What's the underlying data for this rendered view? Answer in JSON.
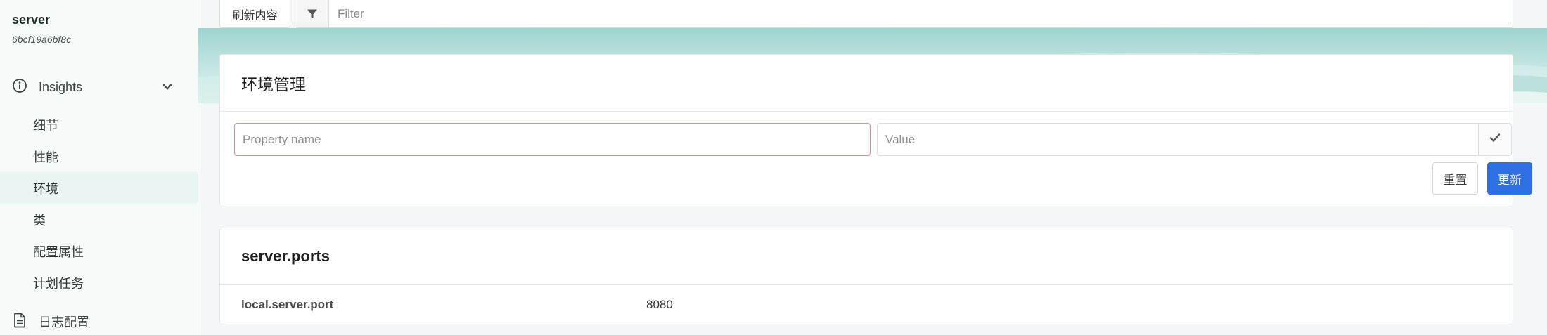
{
  "sidebar": {
    "instance_name": "server",
    "instance_id": "6bcf19a6bf8c",
    "insights_label": "Insights",
    "items": [
      {
        "label": "细节"
      },
      {
        "label": "性能"
      },
      {
        "label": "环境"
      },
      {
        "label": "类"
      },
      {
        "label": "配置属性"
      },
      {
        "label": "计划任务"
      }
    ],
    "active_index": 2,
    "logging_label": "日志配置"
  },
  "toolbar": {
    "refresh_label": "刷新内容",
    "filter_placeholder": "Filter"
  },
  "env_manager": {
    "title": "环境管理",
    "name_placeholder": "Property name",
    "value_placeholder": "Value",
    "reset_label": "重置",
    "update_label": "更新"
  },
  "property_source": {
    "title": "server.ports",
    "rows": [
      {
        "key": "local.server.port",
        "value": "8080"
      }
    ]
  },
  "colors": {
    "accent": "#2f6fe4",
    "hero_teal": "#9fd3cf",
    "error_border": "#f08a8a"
  }
}
